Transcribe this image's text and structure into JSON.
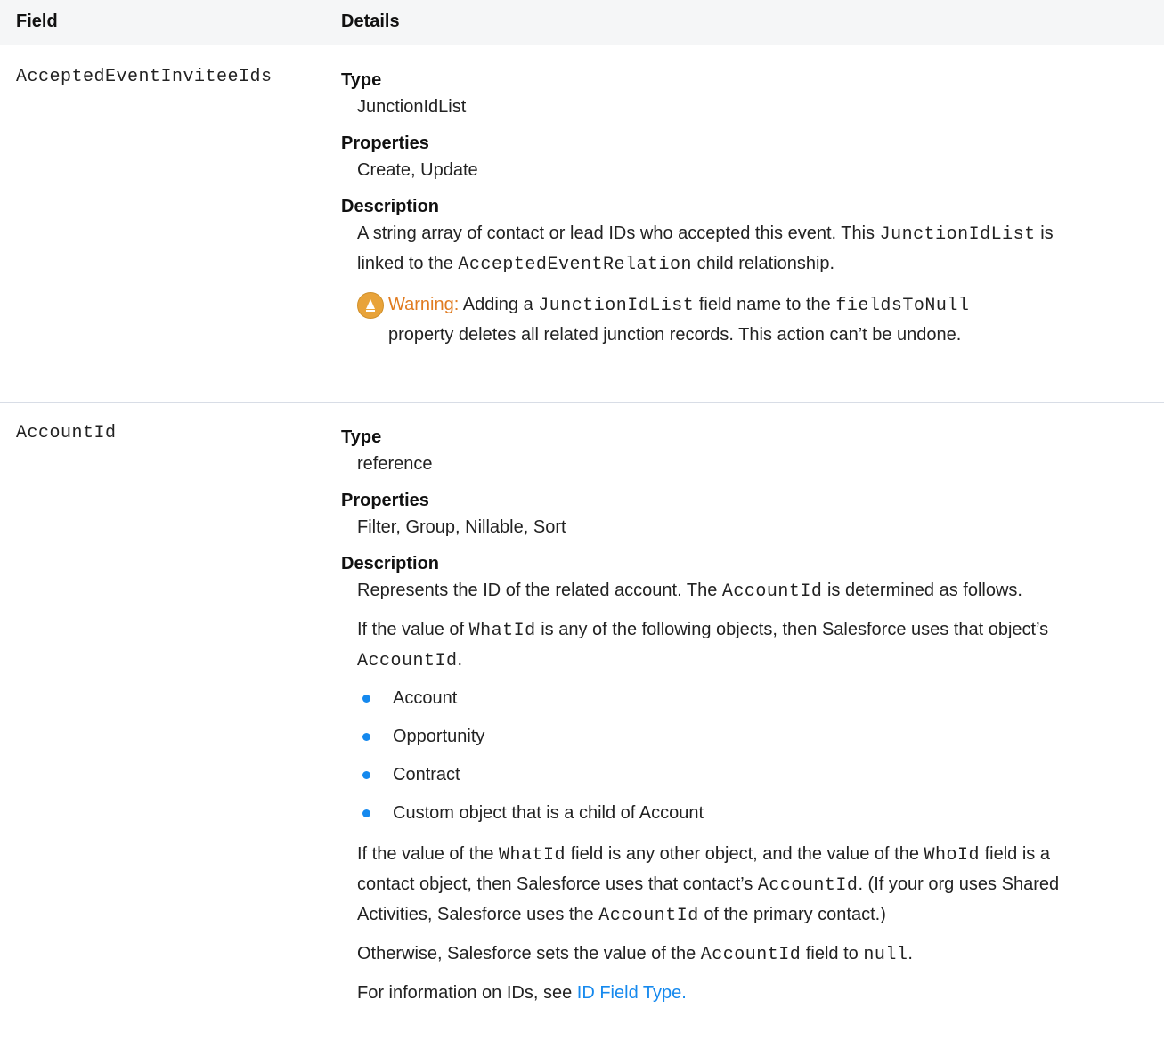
{
  "header": {
    "col_field": "Field",
    "col_details": "Details"
  },
  "rows": [
    {
      "field": "AcceptedEventInviteeIds",
      "type_label": "Type",
      "type_value": "JunctionIdList",
      "properties_label": "Properties",
      "properties_value": "Create, Update",
      "description_label": "Description",
      "desc_1": "A string array of contact or lead IDs who accepted this event. This",
      "desc_code_1": "JunctionIdList",
      "desc_2": "is",
      "desc_3": "linked to the",
      "desc_code_2": "AcceptedEventRelation",
      "desc_4": "child relationship.",
      "warning_title": "Warning:",
      "warning_1": "Adding a",
      "warning_code_1": "JunctionIdList",
      "warning_2": "field name to the",
      "warning_code_2": "fieldsToNull",
      "warning_3": "property deletes all related junction records. This action can’t be undone."
    },
    {
      "field": "AccountId",
      "type_label": "Type",
      "type_value": "reference",
      "properties_label": "Properties",
      "properties_value": "Filter, Group, Nillable, Sort",
      "description_label": "Description",
      "p1_a": "Represents the ID of the related account. The",
      "p1_code": "AccountId",
      "p1_b": "is determined as follows.",
      "p2_a": "If the value of",
      "p2_code_1": "WhatId",
      "p2_b": "is any of the following objects, then Salesforce uses that object’s",
      "p2_code_2": "AccountId",
      "p2_c": ".",
      "bullets": [
        "Account",
        "Opportunity",
        "Contract",
        "Custom object that is a child of Account"
      ],
      "p3_a": "If the value of the",
      "p3_code_1": "WhatId",
      "p3_b": "field is any other object, and the value of the",
      "p3_code_2": "WhoId",
      "p3_c": "field is a",
      "p3_d": "contact object, then Salesforce uses that contact’s",
      "p3_code_3": "AccountId",
      "p3_e": ". (If your org uses Shared",
      "p3_f": "Activities, Salesforce uses the",
      "p3_code_4": "AccountId",
      "p3_g": "of the primary contact.)",
      "p4_a": "Otherwise, Salesforce sets the value of the",
      "p4_code_1": "AccountId",
      "p4_b": "field to",
      "p4_code_2": "null",
      "p4_c": ".",
      "p5_a": "For information on IDs, see",
      "p5_link": "ID Field Type."
    }
  ],
  "colors": {
    "link": "#1589ee",
    "warning_text": "#e07b20",
    "warning_icon": "#e8a33a",
    "bullet": "#1589ee"
  }
}
